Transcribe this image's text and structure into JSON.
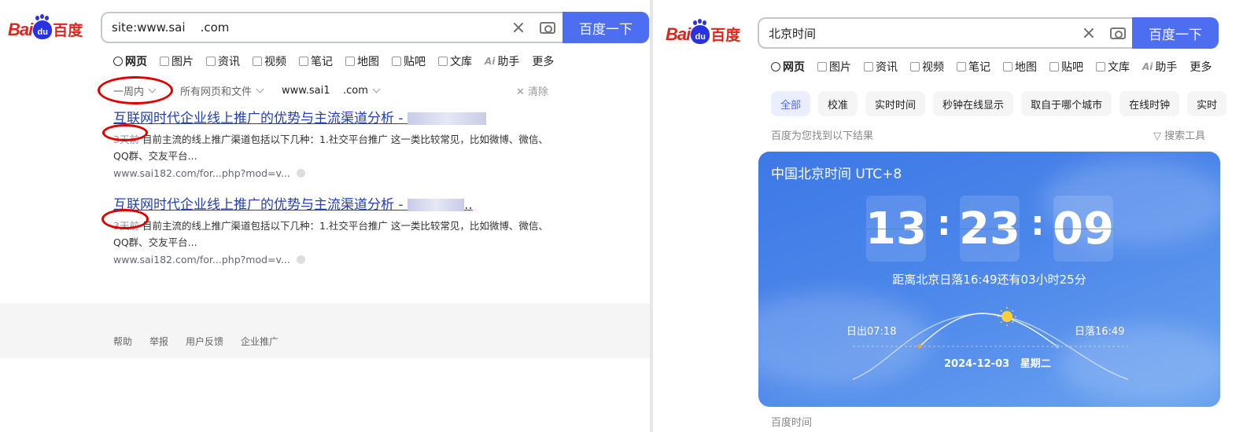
{
  "left": {
    "search": {
      "query": "site:www.sai    .com",
      "button": "百度一下"
    },
    "tabs": [
      {
        "label": "网页",
        "icon": "search-icon"
      },
      {
        "label": "图片",
        "icon": "image-icon"
      },
      {
        "label": "资讯",
        "icon": "news-icon"
      },
      {
        "label": "视频",
        "icon": "video-icon"
      },
      {
        "label": "笔记",
        "icon": "note-icon"
      },
      {
        "label": "地图",
        "icon": "map-icon"
      },
      {
        "label": "贴吧",
        "icon": "tieba-icon"
      },
      {
        "label": "文库",
        "icon": "wenku-icon"
      },
      {
        "label": "助手",
        "icon": "ai-icon"
      },
      {
        "label": "更多",
        "icon": ""
      }
    ],
    "filters": {
      "time": "一周内",
      "type": "所有网页和文件",
      "site": "www.sai1    .com",
      "clear": "清除"
    },
    "results": [
      {
        "title": "互联网时代企业线上推广的优势与主流渠道分析 - ",
        "date": "3天前",
        "desc": "目前主流的线上推广渠道包括以下几种：1.社交平台推广 这一类比较常见，比如微博、微信、QQ群、交友平台...",
        "url": "www.sai182.com/for...php?mod=v..."
      },
      {
        "title": "互联网时代企业线上推广的优势与主流渠道分析 - ",
        "title_suffix": "..",
        "date": "3天前",
        "desc": "目前主流的线上推广渠道包括以下几种：1.社交平台推广 这一类比较常见，比如微博、微信、QQ群、交友平台...",
        "url": "www.sai182.com/for...php?mod=v..."
      }
    ],
    "footer": [
      "帮助",
      "举报",
      "用户反馈",
      "企业推广"
    ]
  },
  "right": {
    "search": {
      "query": "北京时间",
      "button": "百度一下"
    },
    "tabs": [
      {
        "label": "网页",
        "icon": "search-icon"
      },
      {
        "label": "图片",
        "icon": "image-icon"
      },
      {
        "label": "资讯",
        "icon": "news-icon"
      },
      {
        "label": "视频",
        "icon": "video-icon"
      },
      {
        "label": "笔记",
        "icon": "note-icon"
      },
      {
        "label": "地图",
        "icon": "map-icon"
      },
      {
        "label": "贴吧",
        "icon": "tieba-icon"
      },
      {
        "label": "文库",
        "icon": "wenku-icon"
      },
      {
        "label": "助手",
        "icon": "ai-icon"
      },
      {
        "label": "更多",
        "icon": ""
      }
    ],
    "chips": [
      "全部",
      "校准",
      "实时时间",
      "秒钟在线显示",
      "取自于哪个城市",
      "在线时钟",
      "实时"
    ],
    "found": "百度为您找到以下结果",
    "tools": "搜索工具",
    "card": {
      "title": "中国北京时间 UTC+8",
      "hh": "13",
      "mm": "23",
      "ss": "09",
      "sep": ":",
      "sunset_countdown": "距离北京日落16:49还有03小时25分",
      "sunrise": "日出07:18",
      "sunset": "日落16:49",
      "date": "2024-12-03   星期二"
    },
    "bottom_label": "百度时间"
  },
  "colors": {
    "accent": "#4e6ef2",
    "link": "#2440b3",
    "logo_red": "#e1251b",
    "logo_blue": "#2932e1",
    "annotation": "#e00000"
  }
}
